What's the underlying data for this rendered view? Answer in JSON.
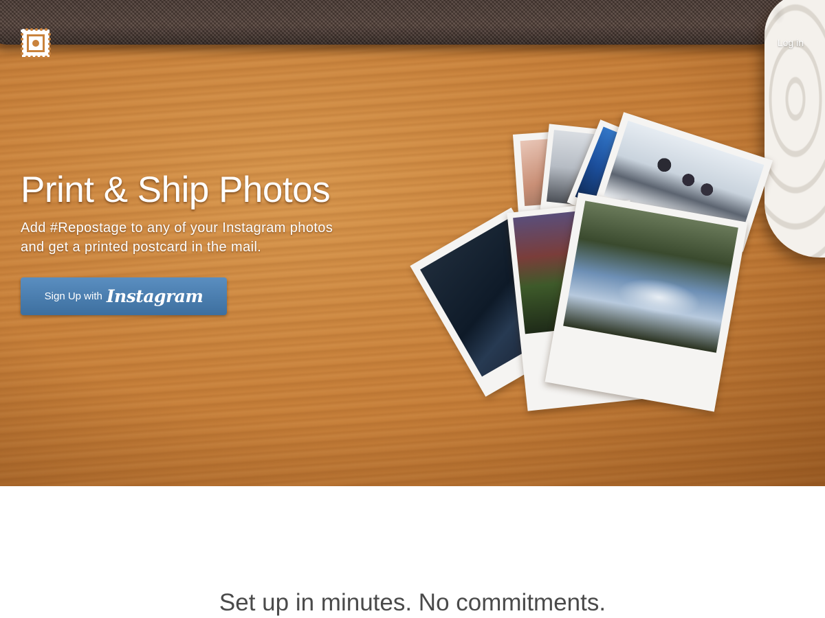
{
  "nav": {
    "logo_icon": "stamp-logo-icon",
    "login_label": "Log in"
  },
  "hero": {
    "title": "Print & Ship Photos",
    "subtitle_line1": "Add #Repostage to any of your Instagram photos",
    "subtitle_line2": "and get a printed postcard in the mail.",
    "signup": {
      "lead": "Sign Up with",
      "brand": "Instagram",
      "color": "#4a7db0"
    }
  },
  "section": {
    "tagline": "Set up in minutes. No commitments."
  }
}
